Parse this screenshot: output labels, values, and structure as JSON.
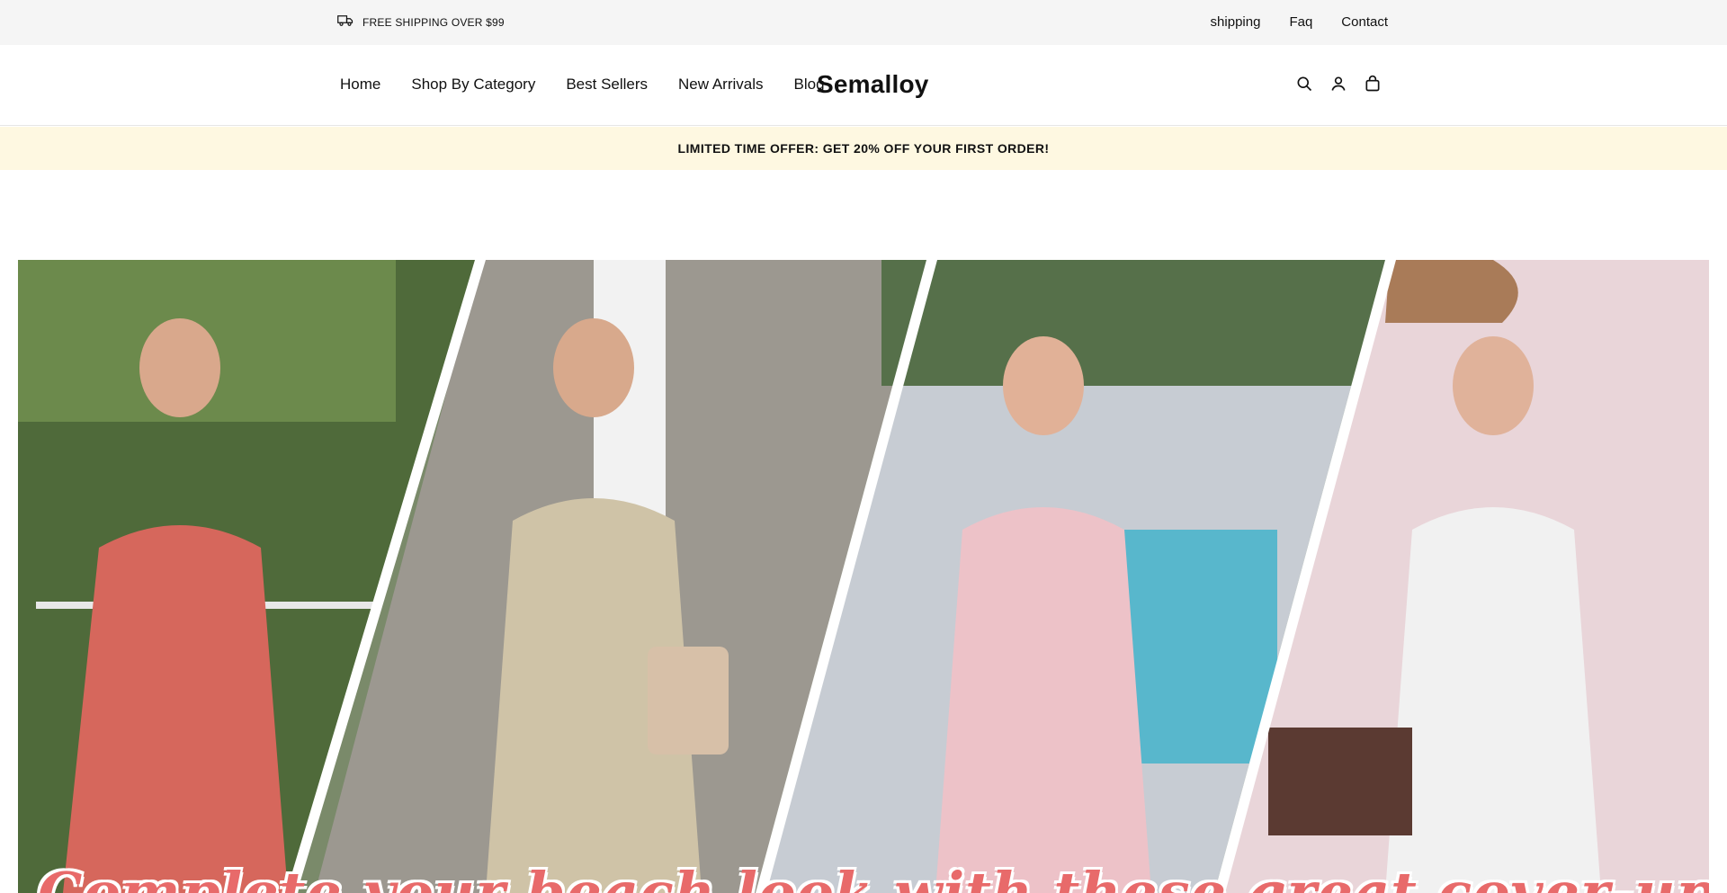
{
  "topbar": {
    "shipping_text": "FREE SHIPPING OVER $99",
    "links": [
      "shipping",
      "Faq",
      "Contact"
    ]
  },
  "header": {
    "nav": [
      "Home",
      "Shop By Category",
      "Best Sellers",
      "New Arrivals",
      "Blog"
    ],
    "logo": "Semalloy",
    "icons": [
      "search-icon",
      "account-icon",
      "cart-bag-icon"
    ]
  },
  "promo": {
    "text": "LIMITED TIME OFFER: GET 20% OFF YOUR FIRST ORDER!"
  },
  "hero": {
    "caption": "Complete your beach look with these great cover-up styles."
  },
  "colors": {
    "topbar_bg": "#f5f5f5",
    "promo_bg": "#fef8e1",
    "caption_color": "#e86a6a"
  }
}
